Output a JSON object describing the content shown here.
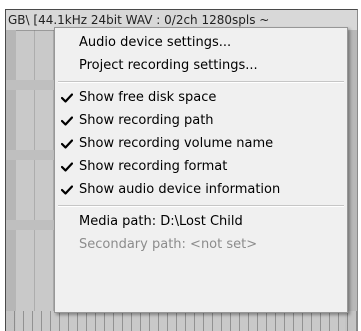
{
  "background": {
    "status_text": "GB\\ [44.1kHz 24bit WAV : 0/2ch 1280spls ~"
  },
  "menu": {
    "group1": [
      {
        "label": "Audio device settings..."
      },
      {
        "label": "Project recording settings..."
      }
    ],
    "group2": [
      {
        "label": "Show free disk space",
        "checked": true
      },
      {
        "label": "Show recording path",
        "checked": true
      },
      {
        "label": "Show recording volume name",
        "checked": true
      },
      {
        "label": "Show recording format",
        "checked": true
      },
      {
        "label": "Show audio device information",
        "checked": true
      }
    ],
    "group3": [
      {
        "label": "Media path: D:\\Lost Child",
        "enabled": true
      },
      {
        "label": "Secondary path: <not set>",
        "enabled": false
      }
    ]
  },
  "icons": {
    "check": "checkmark-icon"
  },
  "colors": {
    "menu_background": "#f0f0f0",
    "disabled_text": "#8c8c8c"
  }
}
